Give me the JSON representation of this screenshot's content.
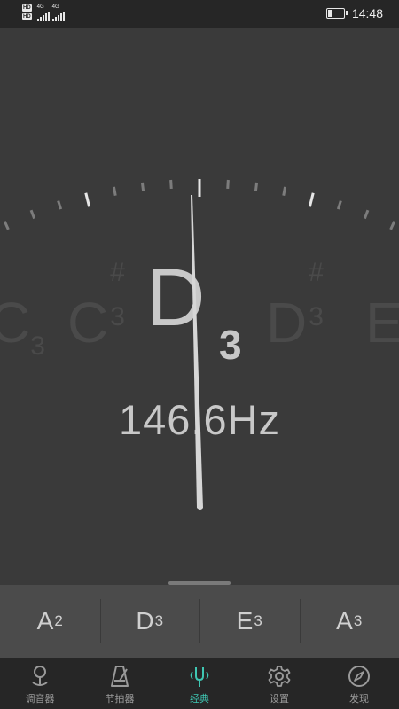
{
  "status_bar": {
    "badges": [
      "HD",
      "HD"
    ],
    "network_1": "4G",
    "network_2": "4G",
    "time": "14:48"
  },
  "tuner": {
    "current_note": "D",
    "current_octave": "3",
    "frequency": "146.6Hz",
    "neighbor_notes": [
      {
        "note": "C",
        "sharp": "",
        "octave": "3"
      },
      {
        "note": "C",
        "sharp": "#",
        "octave": "3"
      },
      {
        "note": "D",
        "sharp": "#",
        "octave": "3"
      },
      {
        "note": "E",
        "sharp": "",
        "octave": ""
      }
    ]
  },
  "strings": [
    {
      "note": "A",
      "octave": "2"
    },
    {
      "note": "D",
      "octave": "3"
    },
    {
      "note": "E",
      "octave": "3"
    },
    {
      "note": "A",
      "octave": "3"
    }
  ],
  "tabs": [
    {
      "label": "调音器",
      "icon": "location-pin-icon",
      "active": false
    },
    {
      "label": "节拍器",
      "icon": "metronome-icon",
      "active": false
    },
    {
      "label": "经典",
      "icon": "tuning-fork-icon",
      "active": true
    },
    {
      "label": "设置",
      "icon": "gear-icon",
      "active": false
    },
    {
      "label": "发现",
      "icon": "compass-icon",
      "active": false
    }
  ],
  "colors": {
    "accent": "#3fc7b3",
    "background": "#3a3a3a",
    "bar": "#262626"
  }
}
